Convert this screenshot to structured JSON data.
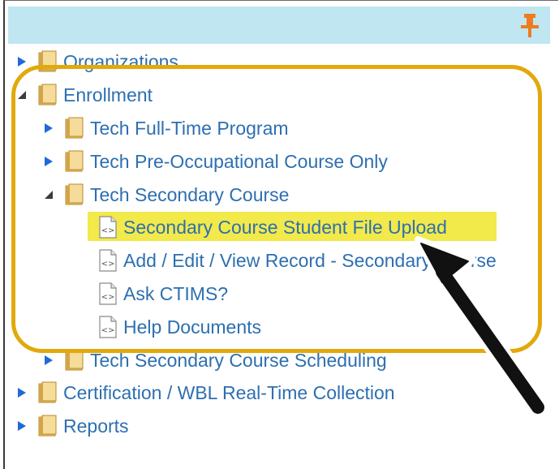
{
  "tree": {
    "organizations": "Organizations",
    "enrollment": "Enrollment",
    "tech_full_time": "Tech Full-Time Program",
    "tech_pre_occupational": "Tech Pre-Occupational Course Only",
    "tech_secondary": "Tech Secondary Course",
    "secondary_upload": "Secondary Course Student File Upload",
    "add_edit_view": "Add / Edit / View Record - Secondary Course",
    "ask_ctims": "Ask CTIMS?",
    "help_documents": "Help Documents",
    "tech_secondary_scheduling": "Tech Secondary Course Scheduling",
    "certification": "Certification / WBL Real-Time Collection",
    "reports": "Reports"
  },
  "colors": {
    "header": "#bfe6f1",
    "link": "#2d6fb0",
    "highlight": "#f2e94a",
    "callout": "#e2a90c",
    "pin": "#f07b1d"
  }
}
